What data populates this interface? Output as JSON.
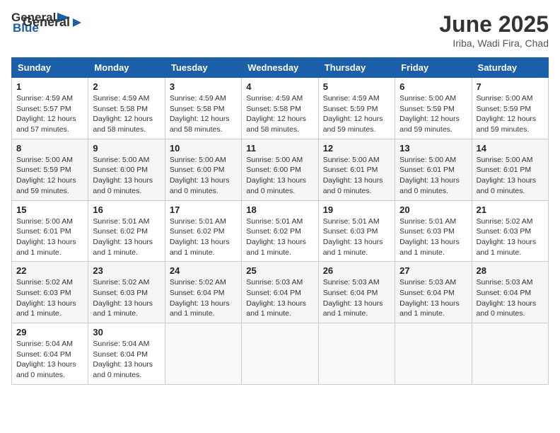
{
  "logo": {
    "general": "General",
    "blue": "Blue"
  },
  "title": "June 2025",
  "location": "Iriba, Wadi Fira, Chad",
  "days_of_week": [
    "Sunday",
    "Monday",
    "Tuesday",
    "Wednesday",
    "Thursday",
    "Friday",
    "Saturday"
  ],
  "weeks": [
    [
      {
        "day": "1",
        "info": "Sunrise: 4:59 AM\nSunset: 5:57 PM\nDaylight: 12 hours\nand 57 minutes."
      },
      {
        "day": "2",
        "info": "Sunrise: 4:59 AM\nSunset: 5:58 PM\nDaylight: 12 hours\nand 58 minutes."
      },
      {
        "day": "3",
        "info": "Sunrise: 4:59 AM\nSunset: 5:58 PM\nDaylight: 12 hours\nand 58 minutes."
      },
      {
        "day": "4",
        "info": "Sunrise: 4:59 AM\nSunset: 5:58 PM\nDaylight: 12 hours\nand 58 minutes."
      },
      {
        "day": "5",
        "info": "Sunrise: 4:59 AM\nSunset: 5:59 PM\nDaylight: 12 hours\nand 59 minutes."
      },
      {
        "day": "6",
        "info": "Sunrise: 5:00 AM\nSunset: 5:59 PM\nDaylight: 12 hours\nand 59 minutes."
      },
      {
        "day": "7",
        "info": "Sunrise: 5:00 AM\nSunset: 5:59 PM\nDaylight: 12 hours\nand 59 minutes."
      }
    ],
    [
      {
        "day": "8",
        "info": "Sunrise: 5:00 AM\nSunset: 5:59 PM\nDaylight: 12 hours\nand 59 minutes."
      },
      {
        "day": "9",
        "info": "Sunrise: 5:00 AM\nSunset: 6:00 PM\nDaylight: 13 hours\nand 0 minutes."
      },
      {
        "day": "10",
        "info": "Sunrise: 5:00 AM\nSunset: 6:00 PM\nDaylight: 13 hours\nand 0 minutes."
      },
      {
        "day": "11",
        "info": "Sunrise: 5:00 AM\nSunset: 6:00 PM\nDaylight: 13 hours\nand 0 minutes."
      },
      {
        "day": "12",
        "info": "Sunrise: 5:00 AM\nSunset: 6:01 PM\nDaylight: 13 hours\nand 0 minutes."
      },
      {
        "day": "13",
        "info": "Sunrise: 5:00 AM\nSunset: 6:01 PM\nDaylight: 13 hours\nand 0 minutes."
      },
      {
        "day": "14",
        "info": "Sunrise: 5:00 AM\nSunset: 6:01 PM\nDaylight: 13 hours\nand 0 minutes."
      }
    ],
    [
      {
        "day": "15",
        "info": "Sunrise: 5:00 AM\nSunset: 6:01 PM\nDaylight: 13 hours\nand 1 minute."
      },
      {
        "day": "16",
        "info": "Sunrise: 5:01 AM\nSunset: 6:02 PM\nDaylight: 13 hours\nand 1 minute."
      },
      {
        "day": "17",
        "info": "Sunrise: 5:01 AM\nSunset: 6:02 PM\nDaylight: 13 hours\nand 1 minute."
      },
      {
        "day": "18",
        "info": "Sunrise: 5:01 AM\nSunset: 6:02 PM\nDaylight: 13 hours\nand 1 minute."
      },
      {
        "day": "19",
        "info": "Sunrise: 5:01 AM\nSunset: 6:03 PM\nDaylight: 13 hours\nand 1 minute."
      },
      {
        "day": "20",
        "info": "Sunrise: 5:01 AM\nSunset: 6:03 PM\nDaylight: 13 hours\nand 1 minute."
      },
      {
        "day": "21",
        "info": "Sunrise: 5:02 AM\nSunset: 6:03 PM\nDaylight: 13 hours\nand 1 minute."
      }
    ],
    [
      {
        "day": "22",
        "info": "Sunrise: 5:02 AM\nSunset: 6:03 PM\nDaylight: 13 hours\nand 1 minute."
      },
      {
        "day": "23",
        "info": "Sunrise: 5:02 AM\nSunset: 6:03 PM\nDaylight: 13 hours\nand 1 minute."
      },
      {
        "day": "24",
        "info": "Sunrise: 5:02 AM\nSunset: 6:04 PM\nDaylight: 13 hours\nand 1 minute."
      },
      {
        "day": "25",
        "info": "Sunrise: 5:03 AM\nSunset: 6:04 PM\nDaylight: 13 hours\nand 1 minute."
      },
      {
        "day": "26",
        "info": "Sunrise: 5:03 AM\nSunset: 6:04 PM\nDaylight: 13 hours\nand 1 minute."
      },
      {
        "day": "27",
        "info": "Sunrise: 5:03 AM\nSunset: 6:04 PM\nDaylight: 13 hours\nand 1 minute."
      },
      {
        "day": "28",
        "info": "Sunrise: 5:03 AM\nSunset: 6:04 PM\nDaylight: 13 hours\nand 0 minutes."
      }
    ],
    [
      {
        "day": "29",
        "info": "Sunrise: 5:04 AM\nSunset: 6:04 PM\nDaylight: 13 hours\nand 0 minutes."
      },
      {
        "day": "30",
        "info": "Sunrise: 5:04 AM\nSunset: 6:04 PM\nDaylight: 13 hours\nand 0 minutes."
      },
      {
        "day": "",
        "info": ""
      },
      {
        "day": "",
        "info": ""
      },
      {
        "day": "",
        "info": ""
      },
      {
        "day": "",
        "info": ""
      },
      {
        "day": "",
        "info": ""
      }
    ]
  ]
}
